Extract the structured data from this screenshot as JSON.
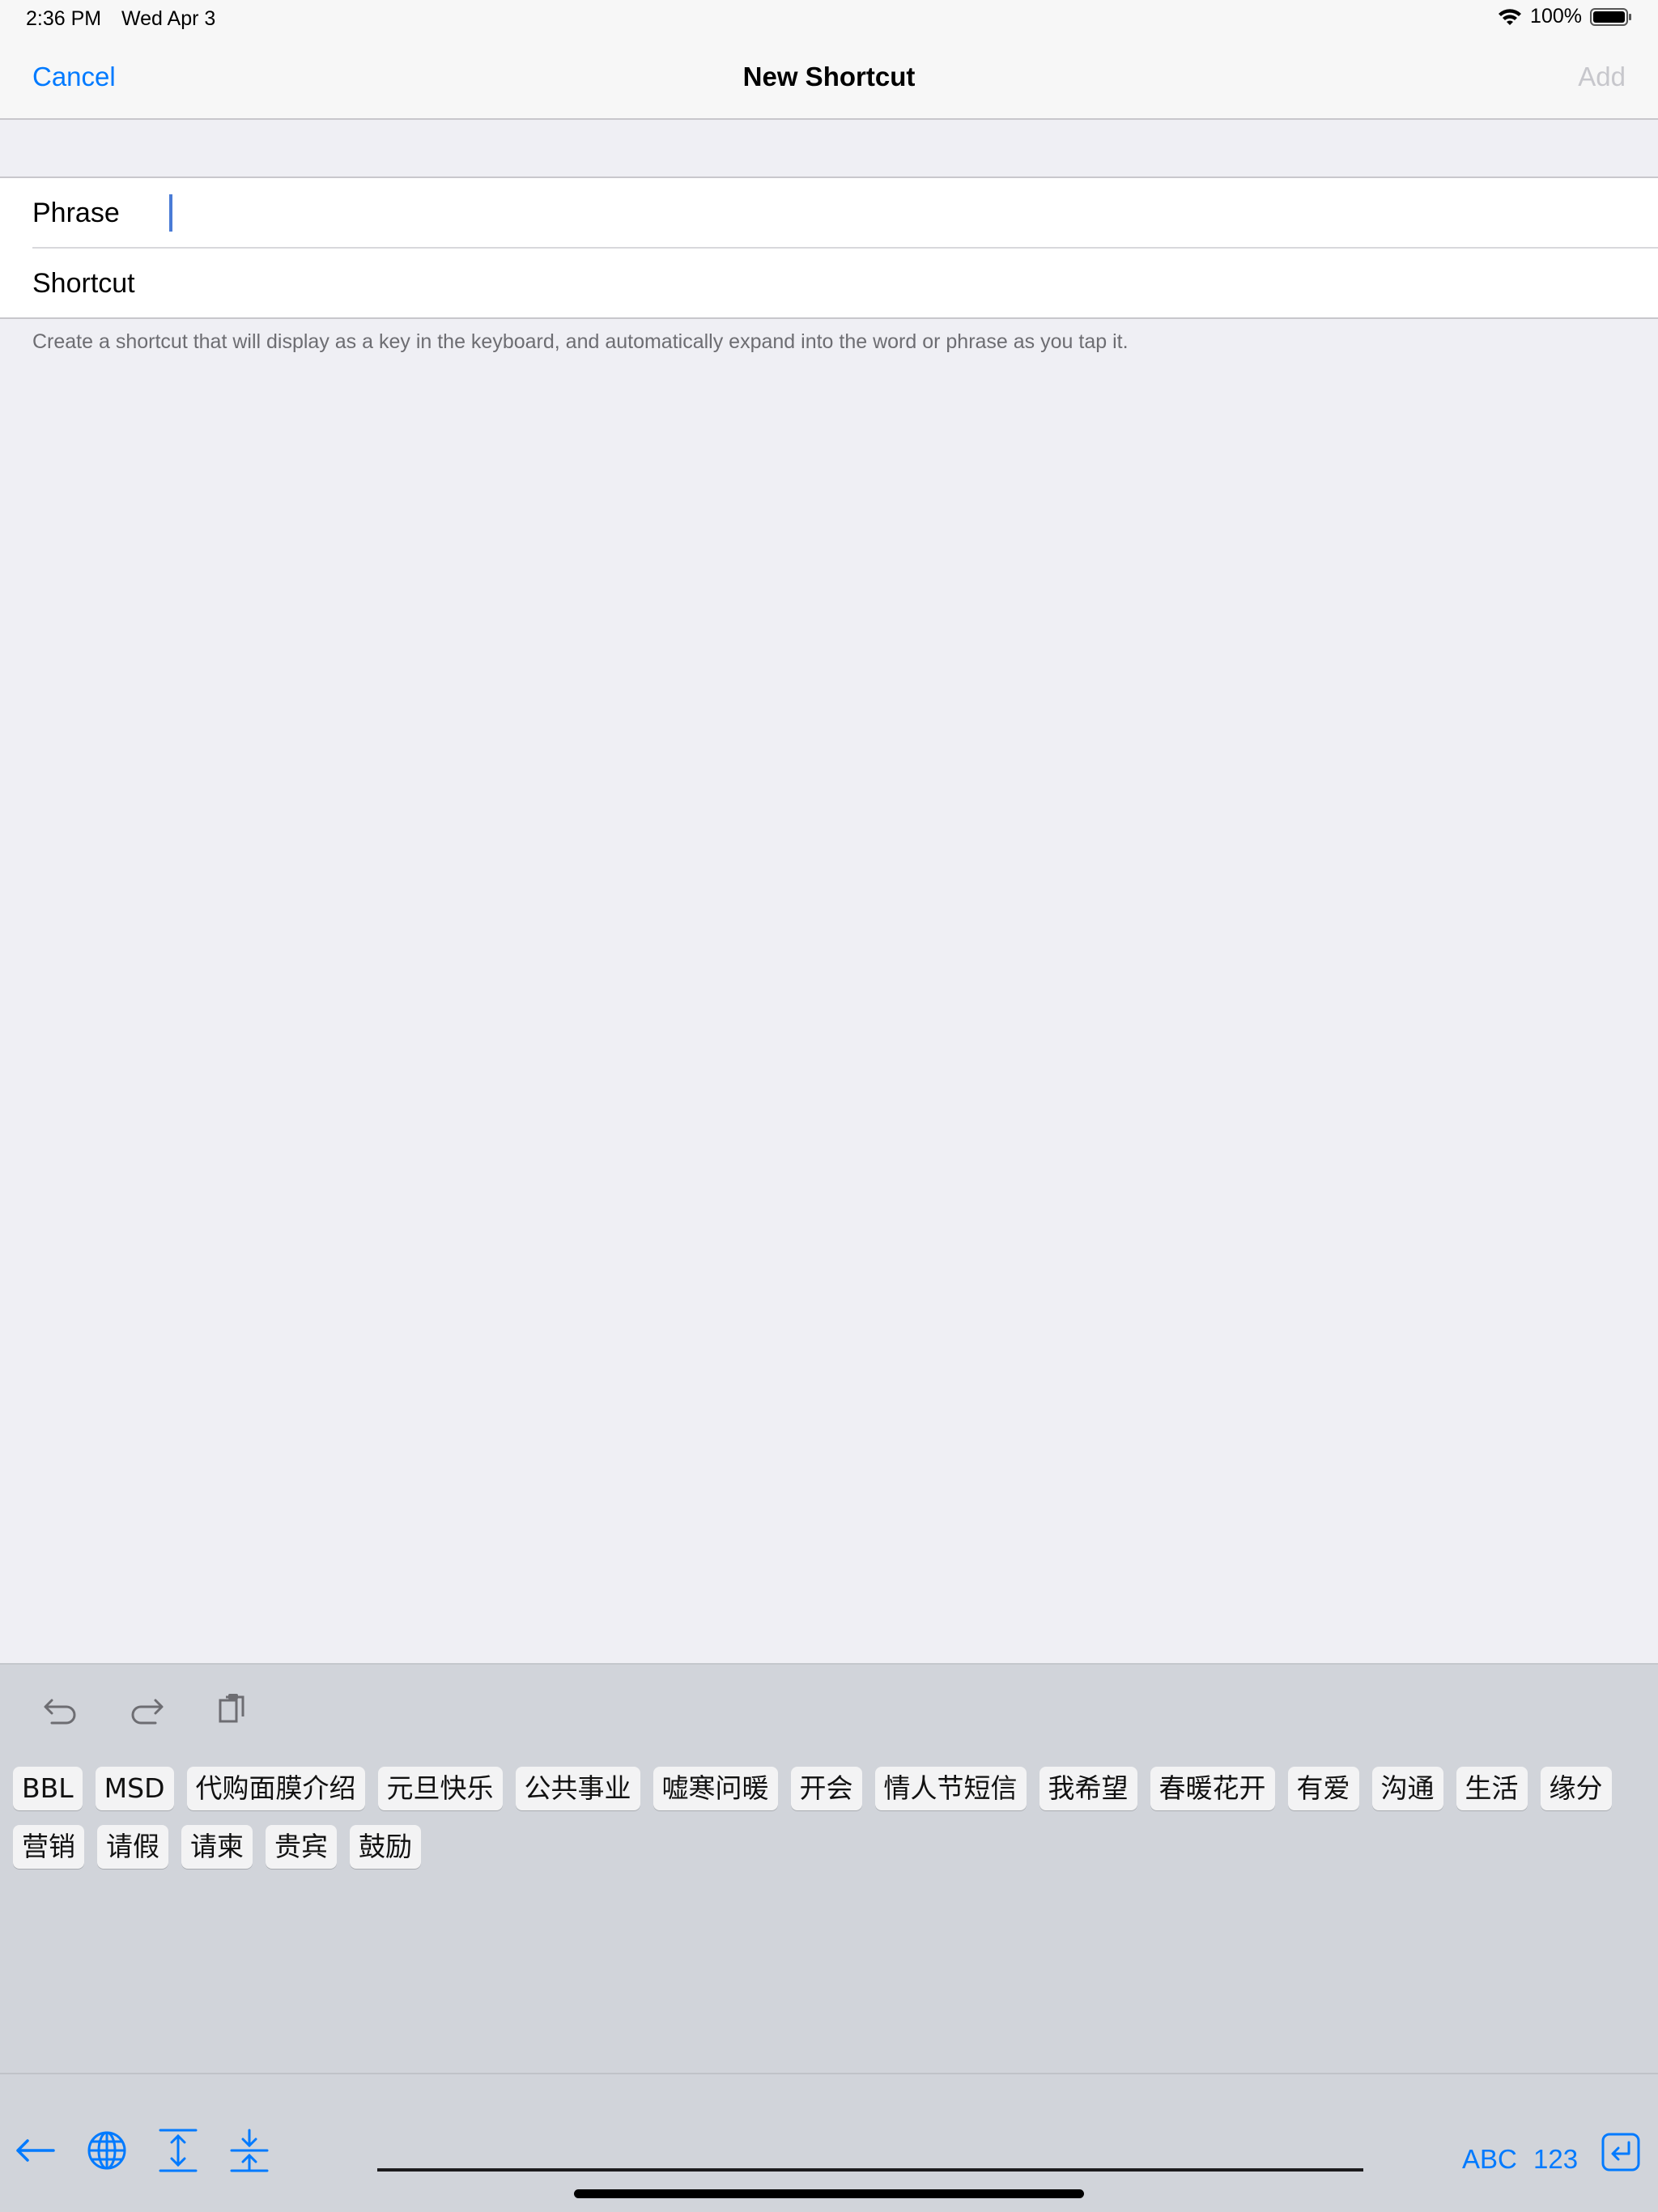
{
  "status_bar": {
    "time": "2:36 PM",
    "date": "Wed Apr 3",
    "battery": "100%",
    "icons": [
      "wifi-icon",
      "battery-icon"
    ]
  },
  "nav": {
    "cancel": "Cancel",
    "title": "New Shortcut",
    "add": "Add"
  },
  "form": {
    "phrase_label": "Phrase",
    "phrase_value": "",
    "shortcut_label": "Shortcut",
    "shortcut_value": "",
    "footer": "Create a shortcut that will display as a key in the keyboard, and automatically expand into the word or phrase as you tap it."
  },
  "keyboard": {
    "tools": [
      "undo-icon",
      "redo-icon",
      "paste-icon"
    ],
    "chips": [
      "BBL",
      "MSD",
      "代购面膜介绍",
      "元旦快乐",
      "公共事业",
      "嘘寒问暖",
      "开会",
      "情人节短信",
      "我希望",
      "春暖花开",
      "有爱",
      "沟通",
      "生活",
      "缘分",
      "营销",
      "请假",
      "请柬",
      "贵宾",
      "鼓励"
    ],
    "bottom_icons": [
      "back-arrow-icon",
      "globe-icon",
      "expand-icon",
      "collapse-icon",
      "return-icon"
    ],
    "abc": "ABC",
    "num": "123"
  },
  "colors": {
    "accent": "#007aff",
    "background": "#efeff4",
    "keyboard": "#d1d4da",
    "disabled": "#c7c7cc",
    "caret": "#4a7bd6"
  }
}
